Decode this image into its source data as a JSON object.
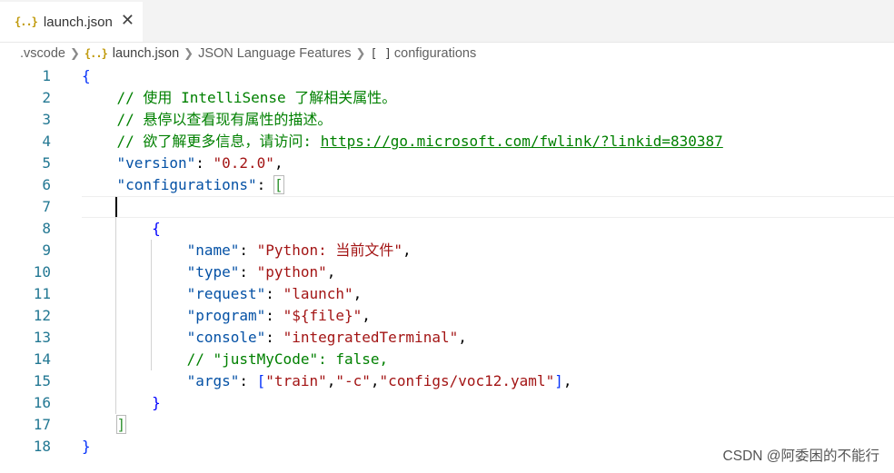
{
  "tab": {
    "label": "launch.json",
    "icon": "json-file-icon"
  },
  "breadcrumb": {
    "items": [
      ".vscode",
      "launch.json",
      "JSON Language Features",
      "configurations"
    ],
    "bracket_glyph": "[ ]"
  },
  "editor": {
    "line_numbers": [
      "1",
      "2",
      "3",
      "4",
      "5",
      "6",
      "7",
      "8",
      "9",
      "10",
      "11",
      "12",
      "13",
      "14",
      "15",
      "16",
      "17",
      "18"
    ],
    "comments": {
      "c1": "// 使用 IntelliSense 了解相关属性。",
      "c2": "// 悬停以查看现有属性的描述。",
      "c3_prefix": "// 欲了解更多信息，请访问: ",
      "c3_link": "https://go.microsoft.com/fwlink/?linkid=830387",
      "c4": "// \"justMyCode\": false,"
    },
    "keys": {
      "version": "\"version\"",
      "configurations": "\"configurations\"",
      "name": "\"name\"",
      "type": "\"type\"",
      "request": "\"request\"",
      "program": "\"program\"",
      "console": "\"console\"",
      "args": "\"args\""
    },
    "values": {
      "version": "\"0.2.0\"",
      "name": "\"Python: 当前文件\"",
      "type": "\"python\"",
      "request": "\"launch\"",
      "program": "\"${file}\"",
      "console": "\"integratedTerminal\"",
      "args_1": "\"train\"",
      "args_2": "\"-c\"",
      "args_3": "\"configs/voc12.yaml\""
    }
  },
  "watermark": "CSDN @阿委困的不能行",
  "colors": {
    "line_number": "#237893",
    "key": "#0451a5",
    "string": "#a31515",
    "comment": "#008000"
  }
}
